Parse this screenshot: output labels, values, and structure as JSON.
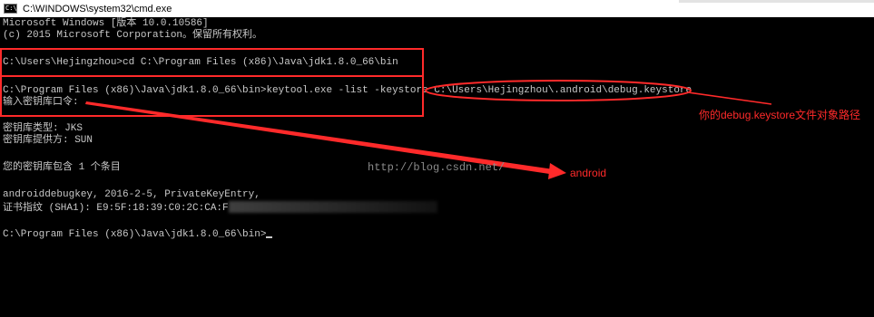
{
  "window": {
    "title": "C:\\WINDOWS\\system32\\cmd.exe",
    "icon_text": "C:\\"
  },
  "console": {
    "lines": [
      "Microsoft Windows [版本 10.0.10586]",
      "(c) 2015 Microsoft Corporation。保留所有权利。",
      "",
      "C:\\Users\\Hejingzhou>cd C:\\Program Files (x86)\\Java\\jdk1.8.0_66\\bin",
      "",
      "C:\\Program Files (x86)\\Java\\jdk1.8.0_66\\bin>keytool.exe -list -keystore C:\\Users\\Hejingzhou\\.android\\debug.keystore",
      "输入密钥库口令:",
      "",
      "密钥库类型: JKS",
      "密钥库提供方: SUN",
      "",
      "您的密钥库包含 1 个条目",
      "",
      "androiddebugkey, 2016-2-5, PrivateKeyEntry,",
      "证书指纹 (SHA1): E9:5F:18:39:C0:2C:CA:F",
      "",
      "C:\\Program Files (x86)\\Java\\jdk1.8.0_66\\bin>"
    ]
  },
  "annotations": {
    "keystore_path_label": "你的debug.keystore文件对象路径",
    "password_label": "android",
    "watermark": "http://blog.csdn.net/",
    "color": "#ff2a2a"
  }
}
